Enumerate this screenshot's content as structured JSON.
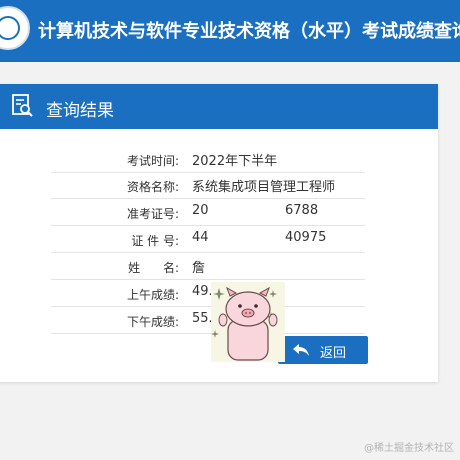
{
  "header": {
    "title": "计算机技术与软件专业技术资格（水平）考试成绩查询"
  },
  "card": {
    "title": "查询结果"
  },
  "result_rows": [
    {
      "label": "考试时间:",
      "value": "2022年下半年"
    },
    {
      "label": "资格名称:",
      "value": "系统集成项目管理工程师"
    },
    {
      "label": "准考证号:",
      "value": "20",
      "value_tail": "6788"
    },
    {
      "label": "证 件 号:",
      "value": "44",
      "value_tail": "40975"
    },
    {
      "label": "姓      名:",
      "value": "詹"
    },
    {
      "label": "上午成绩:",
      "value": "49.00"
    },
    {
      "label": "下午成绩:",
      "value": "55.00"
    }
  ],
  "back_button": {
    "label": "返回"
  },
  "watermark": "@稀土掘金技术社区",
  "icons": {
    "header_logo": "emblem-logo-icon",
    "card": "search-document-icon",
    "back": "return-arrow-icon",
    "sticker": "pig-sticker-icon"
  },
  "colors": {
    "primary": "#1a6fc0",
    "background": "#f2f2f2"
  }
}
